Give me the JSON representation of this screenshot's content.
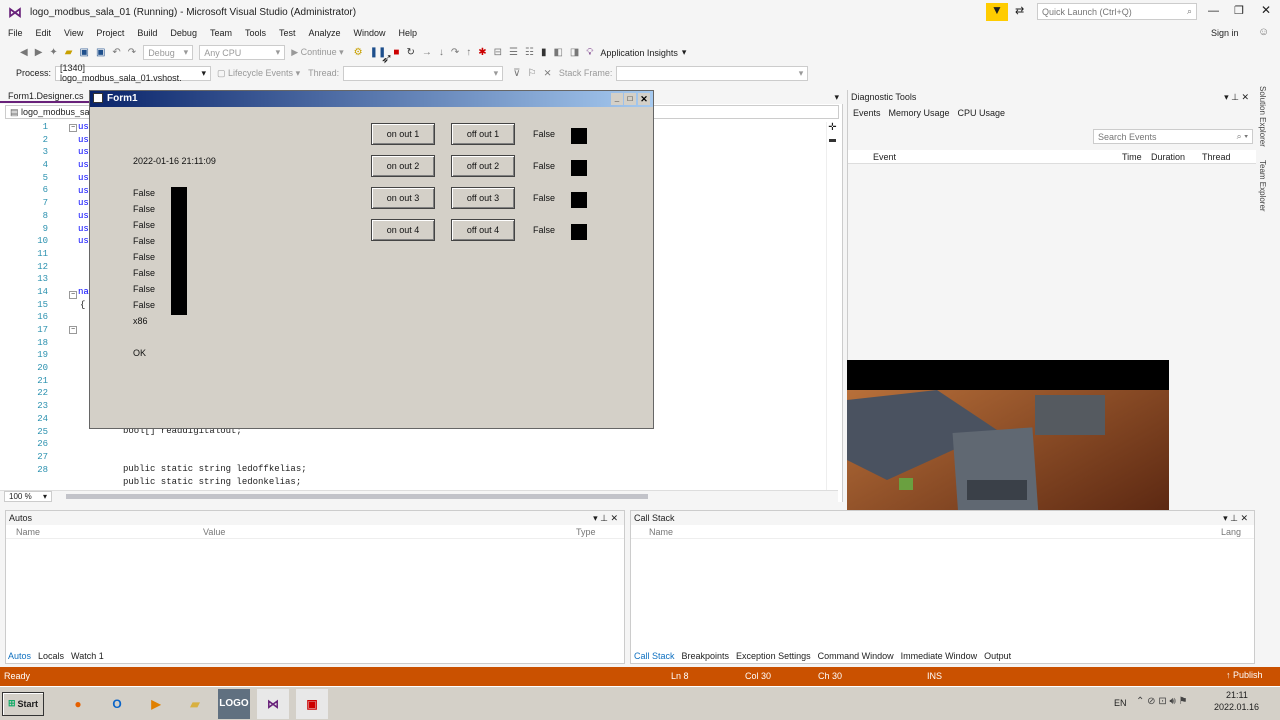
{
  "window": {
    "title": "logo_modbus_sala_01 (Running) - Microsoft Visual Studio (Administrator)",
    "quick_launch": "Quick Launch (Ctrl+Q)",
    "sign_in": "Sign in"
  },
  "menu": [
    "File",
    "Edit",
    "View",
    "Project",
    "Build",
    "Debug",
    "Team",
    "Tools",
    "Test",
    "Analyze",
    "Window",
    "Help"
  ],
  "toolbar": {
    "config": "Debug",
    "platform": "Any CPU",
    "continue": "Continue",
    "app_insights": "Application Insights"
  },
  "process_bar": {
    "process_label": "Process:",
    "process_value": "[1340] logo_modbus_sala_01.vshost.",
    "lifecycle": "Lifecycle Events",
    "thread_label": "Thread:",
    "stack_label": "Stack Frame:"
  },
  "editor": {
    "tab": "Form1.Designer.cs",
    "nav": "logo_modbus_sal",
    "zoom": "100 %",
    "line_numbers": [
      "1",
      "2",
      "3",
      "4",
      "5",
      "6",
      "7",
      "8",
      "9",
      "10",
      "11",
      "12",
      "13",
      "14",
      "15",
      "16",
      "17",
      "18",
      "19",
      "20",
      "21",
      "22",
      "23",
      "24",
      "25",
      "26",
      "27",
      "28"
    ],
    "visible_code": [
      {
        "line": "24",
        "text": "bool[] readdigitalout;"
      },
      {
        "line": "27",
        "text": "public static string ledoffkelias;"
      },
      {
        "line": "28",
        "text": "public static string ledonkelias;"
      }
    ],
    "fragments": [
      "us",
      "us",
      "us",
      "us",
      "us",
      "us",
      "us",
      "us",
      "us",
      "us",
      "na",
      "{"
    ]
  },
  "form": {
    "title": "Form1",
    "datetime": "2022-01-16  21:11:09",
    "input_states": [
      "False",
      "False",
      "False",
      "False",
      "False",
      "False",
      "False",
      "False"
    ],
    "arch": "x86",
    "status": "OK",
    "rows": [
      {
        "on": "on out 1",
        "off": "off out 1",
        "state": "False"
      },
      {
        "on": "on out 2",
        "off": "off out 2",
        "state": "False"
      },
      {
        "on": "on out 3",
        "off": "off out 3",
        "state": "False"
      },
      {
        "on": "on out 4",
        "off": "off out 4",
        "state": "False"
      }
    ]
  },
  "diagnostics": {
    "title": "Diagnostic Tools",
    "tabs": [
      "Events",
      "Memory Usage",
      "CPU Usage"
    ],
    "search_placeholder": "Search Events",
    "columns": [
      "Event",
      "Time",
      "Duration",
      "Thread"
    ]
  },
  "side_tabs": [
    "Solution Explorer",
    "Team Explorer"
  ],
  "autos": {
    "title": "Autos",
    "columns": [
      "Name",
      "Value",
      "Type"
    ],
    "tabs": [
      "Autos",
      "Locals",
      "Watch 1"
    ]
  },
  "callstack": {
    "title": "Call Stack",
    "columns": [
      "Name",
      "Lang"
    ],
    "tabs": [
      "Call Stack",
      "Breakpoints",
      "Exception Settings",
      "Command Window",
      "Immediate Window",
      "Output"
    ]
  },
  "status": {
    "ready": "Ready",
    "ln": "Ln 8",
    "col": "Col 30",
    "ch": "Ch 30",
    "ins": "INS",
    "publish": "Publish"
  },
  "taskbar": {
    "start": "Start",
    "lang": "EN",
    "time": "21:11",
    "date": "2022.01.16"
  },
  "colors": {
    "status_bar": "#ca5100",
    "accent": "#68217a",
    "keyword": "#0000ff"
  }
}
